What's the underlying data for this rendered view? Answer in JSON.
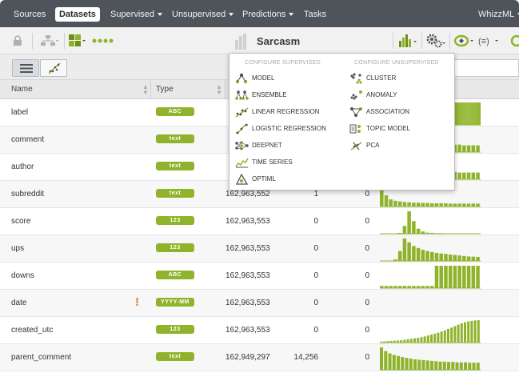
{
  "topnav": {
    "items": [
      {
        "label": "Sources",
        "has_caret": false
      },
      {
        "label": "Datasets",
        "has_caret": false,
        "active": true
      },
      {
        "label": "Supervised",
        "has_caret": true
      },
      {
        "label": "Unsupervised",
        "has_caret": true
      },
      {
        "label": "Predictions",
        "has_caret": true
      },
      {
        "label": "Tasks",
        "has_caret": false
      }
    ],
    "user": "WhizzML"
  },
  "toolbar": {
    "dataset_name": "Sarcasm",
    "left_icons": [
      "lock-icon",
      "dataset-tree-icon",
      "fields-config-icon",
      "status-dots-icon"
    ],
    "right_icons": [
      "charts-icon",
      "configure-gears-icon",
      "configure-models-icon",
      "formula-icon",
      "more-icon"
    ]
  },
  "table": {
    "headers": {
      "name": "Name",
      "type": "Type"
    },
    "rows": [
      {
        "name": "label",
        "type": "ABC",
        "count": "",
        "missing": "",
        "errors": "",
        "hist": [
          0,
          0,
          0,
          0,
          0,
          0,
          0,
          0,
          0,
          0,
          0,
          0,
          0,
          0,
          0,
          0,
          0,
          0,
          0,
          0,
          0,
          0,
          0,
          0,
          0,
          0,
          0,
          0,
          0,
          0,
          0,
          0,
          0,
          0,
          0,
          0,
          0,
          0,
          0,
          0,
          0,
          0,
          0,
          0,
          0,
          0,
          0,
          0,
          0,
          0,
          0,
          0,
          0,
          0,
          0,
          0,
          0,
          0,
          0,
          0,
          0,
          0,
          20,
          20,
          20,
          20,
          20,
          20,
          20,
          20,
          20,
          20,
          20,
          20,
          20,
          20,
          20,
          20,
          20,
          20,
          20,
          20,
          20,
          20,
          20,
          20,
          20,
          20,
          20,
          20,
          20,
          20,
          20,
          20,
          20,
          20,
          20,
          20,
          20,
          20,
          20,
          20,
          20,
          20,
          20,
          20,
          20,
          20,
          20,
          20,
          20,
          20,
          20,
          20,
          20,
          20,
          20,
          20,
          20,
          20,
          20,
          20,
          20,
          20,
          20,
          20,
          20,
          20
        ]
      },
      {
        "name": "comment",
        "type": "text",
        "count": "",
        "missing": "",
        "errors": "",
        "hist": [
          30,
          24,
          20,
          18,
          16,
          15,
          14,
          13,
          13,
          12,
          12,
          11,
          11,
          11,
          10,
          10,
          10,
          10,
          9,
          9,
          9,
          9
        ]
      },
      {
        "name": "author",
        "type": "text",
        "count": "",
        "missing": "",
        "errors": "",
        "hist": [
          30,
          22,
          18,
          16,
          15,
          14,
          13,
          13,
          12,
          12,
          11,
          11,
          11,
          10,
          10,
          10,
          10,
          9,
          9,
          9,
          9,
          9
        ]
      },
      {
        "name": "subreddit",
        "type": "text",
        "count": "162,963,552",
        "missing": "1",
        "errors": "0",
        "hist": [
          70,
          35,
          22,
          18,
          16,
          14,
          13,
          12,
          12,
          11,
          11,
          10,
          10,
          10,
          10,
          9,
          9,
          9,
          9,
          9,
          9,
          9
        ]
      },
      {
        "name": "score",
        "type": "123",
        "count": "162,963,553",
        "missing": "0",
        "errors": "0",
        "hist": [
          0,
          0,
          0,
          0,
          3,
          28,
          80,
          45,
          18,
          8,
          4,
          3,
          2,
          2,
          0,
          0,
          0,
          0,
          0,
          0,
          0,
          0
        ]
      },
      {
        "name": "ups",
        "type": "123",
        "count": "162,963,553",
        "missing": "0",
        "errors": "0",
        "hist": [
          0,
          0,
          0,
          6,
          40,
          90,
          75,
          60,
          52,
          45,
          40,
          36,
          32,
          30,
          28,
          26,
          24,
          22,
          20,
          18,
          17,
          16
        ]
      },
      {
        "name": "downs",
        "type": "ABC",
        "count": "162,963,553",
        "missing": "0",
        "errors": "0",
        "hist": [
          10,
          10,
          10,
          10,
          10,
          10,
          10,
          10,
          10,
          10,
          10,
          10,
          100,
          100,
          100,
          100,
          100,
          100,
          100,
          100,
          100,
          100
        ]
      },
      {
        "name": "date",
        "type": "YYYY-MM",
        "count": "162,963,553",
        "missing": "0",
        "errors": "0",
        "warning": true,
        "hist": []
      },
      {
        "name": "created_utc",
        "type": "123",
        "count": "162,963,553",
        "missing": "0",
        "errors": "0",
        "hist": [
          4,
          5,
          6,
          7,
          8,
          9,
          10,
          12,
          14,
          16,
          18,
          20,
          23,
          26,
          30,
          34,
          38,
          42,
          47,
          52,
          58,
          64,
          70,
          76,
          82,
          86,
          90,
          92,
          94,
          95
        ]
      },
      {
        "name": "parent_comment",
        "type": "text",
        "count": "162,949,297",
        "missing": "14,256",
        "errors": "0",
        "hist": [
          60,
          50,
          44,
          40,
          37,
          34,
          32,
          30,
          28,
          27,
          26,
          25,
          24,
          23,
          22,
          22,
          21,
          21,
          20,
          20,
          20,
          19,
          19,
          19
        ]
      }
    ]
  },
  "dropdown": {
    "supervised_header": "CONFIGURE SUPERVISED",
    "unsupervised_header": "CONFIGURE UNSUPERVISED",
    "supervised": [
      {
        "label": "MODEL",
        "icon": "model-icon"
      },
      {
        "label": "ENSEMBLE",
        "icon": "ensemble-icon"
      },
      {
        "label": "LINEAR REGRESSION",
        "icon": "linear-regression-icon"
      },
      {
        "label": "LOGISTIC REGRESSION",
        "icon": "logistic-regression-icon"
      },
      {
        "label": "DEEPNET",
        "icon": "deepnet-icon"
      },
      {
        "label": "TIME SERIES",
        "icon": "time-series-icon"
      },
      {
        "label": "OPTIML",
        "icon": "optiml-icon"
      }
    ],
    "unsupervised": [
      {
        "label": "CLUSTER",
        "icon": "cluster-icon"
      },
      {
        "label": "ANOMALY",
        "icon": "anomaly-icon"
      },
      {
        "label": "ASSOCIATION",
        "icon": "association-icon"
      },
      {
        "label": "TOPIC MODEL",
        "icon": "topic-model-icon"
      },
      {
        "label": "PCA",
        "icon": "pca-icon"
      }
    ]
  },
  "colors": {
    "accent": "#8fb42c",
    "nav_bg": "#4e5459",
    "warning": "#e67e22"
  }
}
